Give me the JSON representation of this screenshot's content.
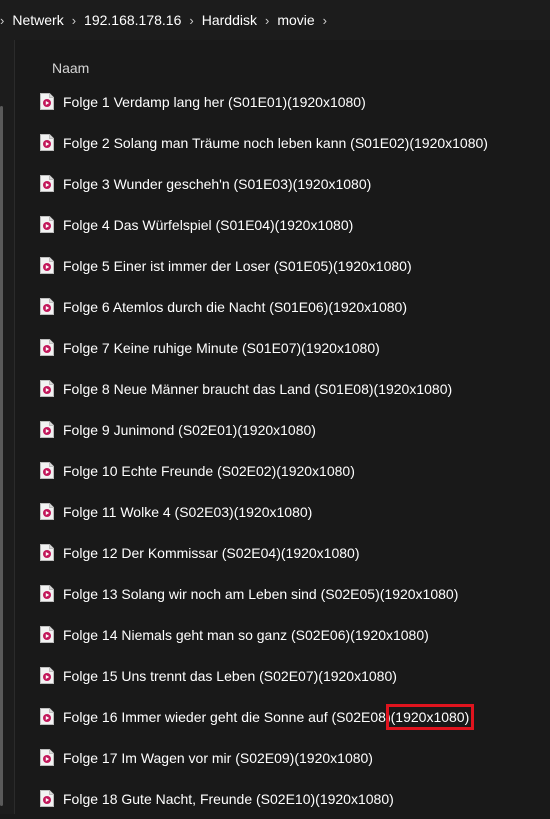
{
  "breadcrumb": {
    "items": [
      "Netwerk",
      "192.168.178.16",
      "Harddisk",
      "movie"
    ],
    "separator": "›"
  },
  "header": {
    "column_name": "Naam"
  },
  "files": [
    {
      "title": "Folge 1 Verdamp lang her (S01E01)",
      "res": "(1920x1080)"
    },
    {
      "title": "Folge 2 Solang man Träume noch leben kann (S01E02)",
      "res": "(1920x1080)"
    },
    {
      "title": "Folge 3 Wunder gescheh'n (S01E03)",
      "res": "(1920x1080)"
    },
    {
      "title": "Folge 4 Das Würfelspiel (S01E04)",
      "res": "(1920x1080)"
    },
    {
      "title": "Folge 5 Einer ist immer der Loser (S01E05)",
      "res": "(1920x1080)"
    },
    {
      "title": "Folge 6 Atemlos durch die Nacht (S01E06)",
      "res": "(1920x1080)"
    },
    {
      "title": "Folge 7 Keine ruhige Minute (S01E07)",
      "res": "(1920x1080)"
    },
    {
      "title": "Folge 8 Neue Männer braucht das Land (S01E08)",
      "res": "(1920x1080)"
    },
    {
      "title": "Folge 9 Junimond (S02E01)",
      "res": "(1920x1080)"
    },
    {
      "title": "Folge 10 Echte Freunde (S02E02)",
      "res": "(1920x1080)"
    },
    {
      "title": "Folge 11 Wolke 4 (S02E03)",
      "res": "(1920x1080)"
    },
    {
      "title": "Folge 12 Der Kommissar (S02E04)",
      "res": "(1920x1080)"
    },
    {
      "title": "Folge 13 Solang wir noch am Leben sind (S02E05)",
      "res": "(1920x1080)"
    },
    {
      "title": "Folge 14 Niemals geht man so ganz (S02E06)",
      "res": "(1920x1080)"
    },
    {
      "title": "Folge 15 Uns trennt das Leben (S02E07)",
      "res": "(1920x1080)"
    },
    {
      "title": "Folge 16 Immer wieder geht die Sonne auf (S02E08)",
      "res": "(1920x1080)",
      "highlighted": true
    },
    {
      "title": "Folge 17 Im Wagen vor mir (S02E09)",
      "res": "(1920x1080)"
    },
    {
      "title": "Folge 18 Gute Nacht, Freunde (S02E10)",
      "res": "(1920x1080)"
    }
  ],
  "file_icon": "video-file-icon",
  "colors": {
    "background": "#191919",
    "highlight_box": "#e0141e",
    "icon_accent": "#c2185b"
  }
}
